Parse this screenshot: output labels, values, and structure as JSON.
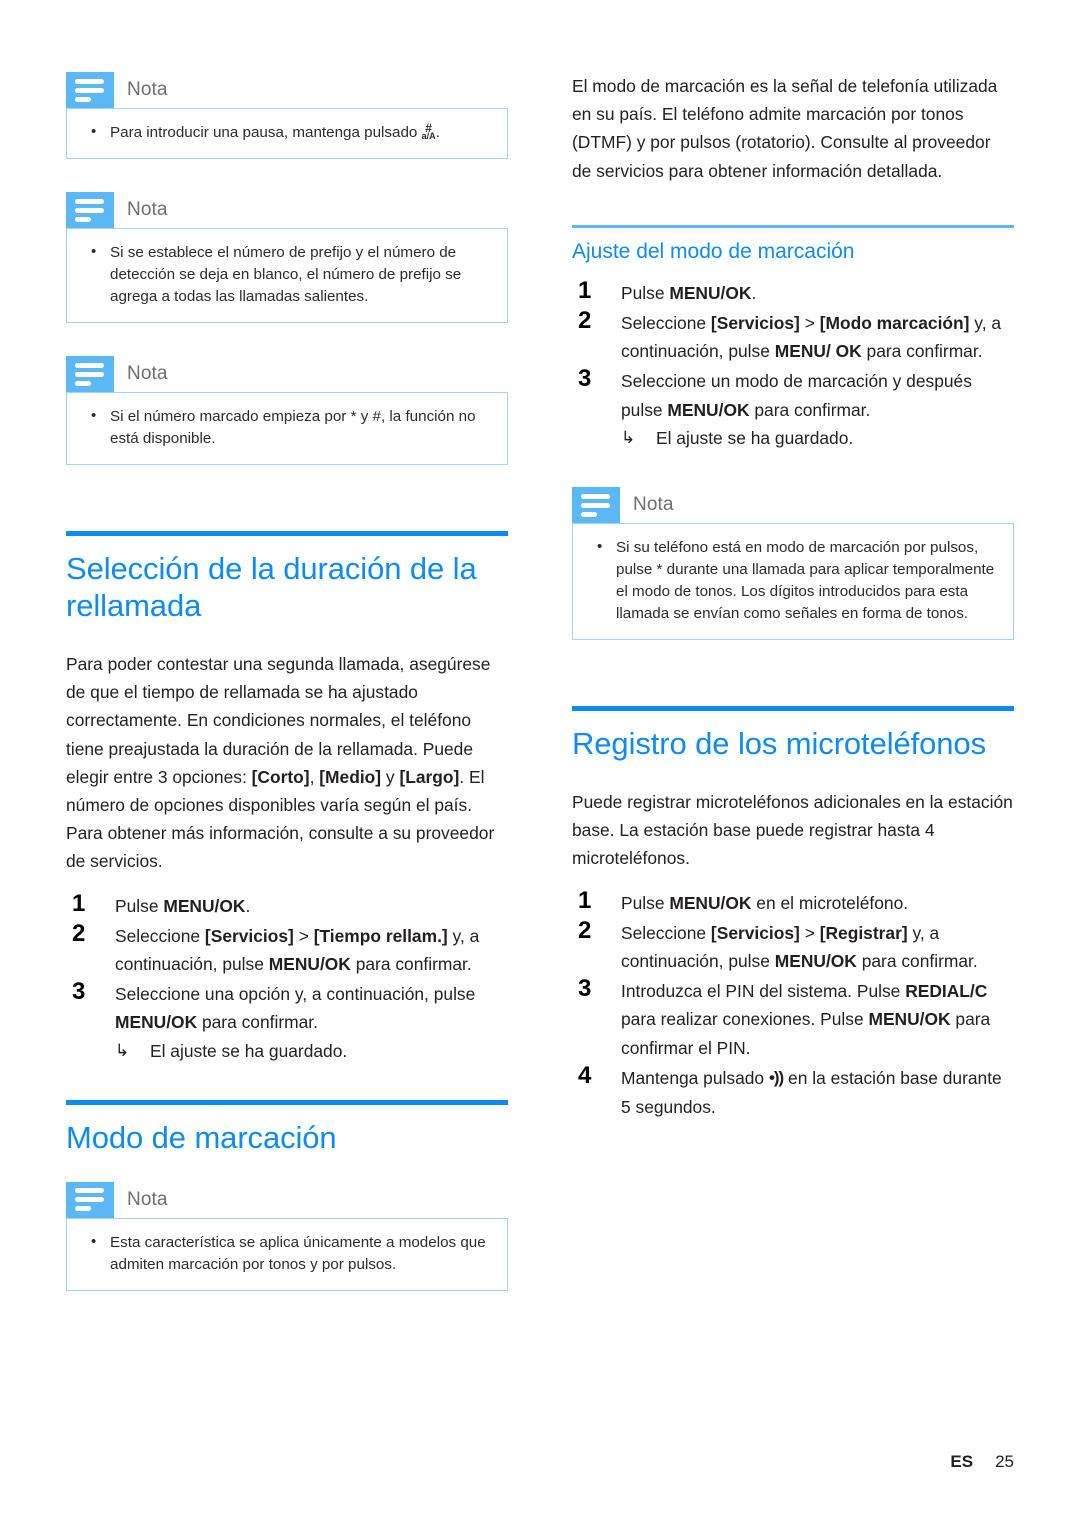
{
  "page": {
    "language_code": "ES",
    "page_number": "25",
    "accent_blue": "#0d8bf2",
    "light_blue": "#5bb8f5",
    "note_border": "#9ed5f7"
  },
  "note_label": "Nota",
  "left_column": {
    "notes": [
      {
        "label": "Nota",
        "text_before_glyph": "Para introducir una pausa, mantenga pulsado ",
        "glyph_top": "#",
        "glyph_bottom": "a/A",
        "text_after_glyph": "."
      },
      {
        "label": "Nota",
        "text": "Si se establece el número de prefijo y el número de detección se deja en blanco, el número de prefijo se agrega a todas las llamadas salientes."
      },
      {
        "label": "Nota",
        "text": "Si el número marcado empieza por * y #, la función no está disponible."
      }
    ],
    "section_heading": "Selección de la duración de la rellamada",
    "intro_parts": {
      "p1": "Para poder contestar una segunda llamada, asegúrese de que el tiempo de rellamada se ha ajustado correctamente. En condiciones normales, el teléfono tiene preajustada la duración de la rellamada. Puede elegir entre 3 opciones: ",
      "opt1": "[Corto]",
      "sep1": ", ",
      "opt2": "[Medio]",
      "sep2": " y ",
      "opt3": "[Largo]",
      "p2": ". El número de opciones disponibles varía según el país. Para obtener más información, consulte a su proveedor de servicios."
    },
    "steps": [
      {
        "num": "1",
        "pre": "Pulse ",
        "bold1": "MENU/OK",
        "mid": ".",
        "bold2": "",
        "post": ""
      },
      {
        "num": "2",
        "pre": "Seleccione ",
        "bold1": "[Servicios]",
        "mid": " > ",
        "bold2": "[Tiempo rellam.]",
        "post": " y, a continuación, pulse ",
        "bold3": "MENU/OK",
        "post2": " para confirmar."
      },
      {
        "num": "3",
        "pre": "Seleccione una opción y, a continuación, pulse ",
        "bold1": "MENU/OK",
        "mid": " para confirmar.",
        "result_arrow": "↳",
        "result": "El ajuste se ha guardado."
      }
    ],
    "section_heading_2": "Modo de marcación",
    "note_bottom": {
      "label": "Nota",
      "text": "Esta característica se aplica únicamente a modelos que admiten marcación por tonos y por pulsos."
    }
  },
  "right_column": {
    "intro": "El modo de marcación es la señal de telefonía utilizada en su país. El teléfono admite marcación por tonos (DTMF) y por pulsos (rotatorio). Consulte al proveedor de servicios para obtener información detallada.",
    "sub_heading": "Ajuste del modo de marcación",
    "steps_dial": [
      {
        "num": "1",
        "pre": "Pulse ",
        "bold1": "MENU/OK",
        "mid": "."
      },
      {
        "num": "2",
        "pre": "Seleccione ",
        "bold1": "[Servicios]",
        "mid": " > ",
        "bold2": "[Modo marcación]",
        "post": " y, a continuación, pulse ",
        "bold3": "MENU/ OK",
        "post2": " para confirmar."
      },
      {
        "num": "3",
        "pre": "Seleccione un modo de marcación y después pulse ",
        "bold1": "MENU/OK",
        "mid": " para confirmar.",
        "result_arrow": "↳",
        "result": "El ajuste se ha guardado."
      }
    ],
    "note": {
      "label": "Nota",
      "text": "Si su teléfono está en modo de marcación por pulsos, pulse * durante una llamada para aplicar temporalmente el modo de tonos. Los dígitos introducidos para esta llamada se envían como señales en forma de tonos."
    },
    "section_heading": "Registro de los microteléfonos",
    "intro2": "Puede registrar microteléfonos adicionales en la estación base. La estación base puede registrar hasta 4 microteléfonos.",
    "steps_register": [
      {
        "num": "1",
        "pre": "Pulse ",
        "bold1": "MENU/OK",
        "mid": " en el microteléfono."
      },
      {
        "num": "2",
        "pre": "Seleccione ",
        "bold1": "[Servicios]",
        "mid": " > ",
        "bold2": "[Registrar]",
        "post": " y, a continuación, pulse ",
        "bold3": "MENU/OK",
        "post2": " para confirmar."
      },
      {
        "num": "3",
        "pre": "Introduzca el PIN del sistema. Pulse ",
        "bold1": "REDIAL/C",
        "mid": " para realizar conexiones. Pulse ",
        "bold2": "MENU/OK",
        "post": " para confirmar el PIN."
      },
      {
        "num": "4",
        "pre": "Mantenga pulsado ",
        "icon": "•))",
        "post": " en la estación base durante 5 segundos."
      }
    ]
  }
}
